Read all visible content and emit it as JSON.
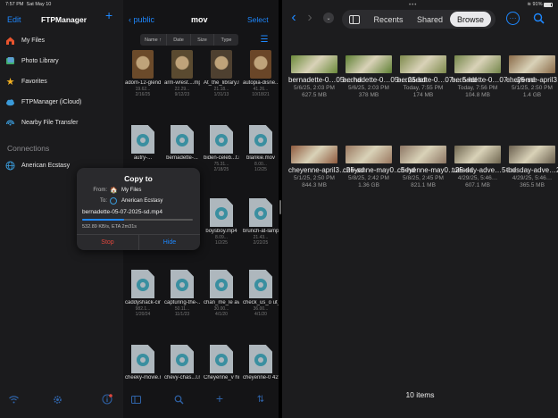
{
  "status_bar": {
    "time": "7:57 PM",
    "date": "Sat May 10",
    "battery_pct": "91%"
  },
  "left_pane": {
    "edit_label": "Edit",
    "title": "FTPManager",
    "add_label": "+",
    "items": [
      {
        "label": "My Files"
      },
      {
        "label": "Photo Library"
      },
      {
        "label": "Favorites"
      },
      {
        "label": "FTPManager (iCloud)"
      },
      {
        "label": "Nearby File Transfer"
      }
    ],
    "connections_header": "Connections",
    "connections": [
      {
        "label": "Anerican Ecstasy"
      }
    ]
  },
  "middle_pane": {
    "back_label": "public",
    "title": "mov",
    "select_label": "Select",
    "sort_tabs": [
      "Name ↑",
      "Date",
      "Size",
      "Type"
    ],
    "files": [
      {
        "name": "adom-12-glend....mp4",
        "size": "19.62...",
        "date": "2/16/25",
        "kind": "video"
      },
      {
        "name": "arm-wrest....mp4",
        "size": "22.29...",
        "date": "9/12/23",
        "kind": "video"
      },
      {
        "name": "At_the_library.mp4",
        "size": "21.18...",
        "date": "1/31/13",
        "kind": "video"
      },
      {
        "name": "autopia-disne....mp4",
        "size": "41.26...",
        "date": "10/18/21",
        "kind": "video"
      },
      {
        "name": "autry-...",
        "size": "",
        "date": "",
        "kind": "icon"
      },
      {
        "name": "bernadette-...",
        "size": "",
        "date": "",
        "kind": "icon"
      },
      {
        "name": "biden-celeb...t.mov",
        "size": "75.31...",
        "date": "2/18/25",
        "kind": "icon"
      },
      {
        "name": "blankie.mov",
        "size": "8.00...",
        "date": "1/2/25",
        "kind": "icon"
      },
      {
        "name": "",
        "size": "",
        "date": "",
        "kind": "icon"
      },
      {
        "name": "",
        "size": "",
        "date": "",
        "kind": "icon"
      },
      {
        "name": "boysboy.mp4",
        "size": "8.09...",
        "date": "1/2/25",
        "kind": "icon"
      },
      {
        "name": "brunch-at-lampl....mp4",
        "size": "21.43...",
        "date": "2/22/25",
        "kind": "icon"
      },
      {
        "name": "caddyshack-cindy....mp4",
        "size": "982.1...",
        "date": "1/20/24",
        "kind": "icon"
      },
      {
        "name": "capturing-the-...nt.mov",
        "size": "50.11...",
        "date": "11/1/23",
        "kind": "icon"
      },
      {
        "name": "chan_me_le aving.mov",
        "size": "30.00...",
        "date": "4/1/20",
        "kind": "icon"
      },
      {
        "name": "check_us_o ut_aug.mp4",
        "size": "36.00...",
        "date": "4/1/20",
        "kind": "icon"
      },
      {
        "name": "cheeky-movie.mp4",
        "size": "",
        "date": "",
        "kind": "icon"
      },
      {
        "name": "chevy-chas...l.mp4",
        "size": "",
        "date": "",
        "kind": "icon"
      },
      {
        "name": "Cheyenne_v his_2.mp4",
        "size": "",
        "date": "",
        "kind": "icon"
      },
      {
        "name": "cheyenne-0 4212...l.mp4",
        "size": "",
        "date": "",
        "kind": "icon"
      }
    ]
  },
  "copy_dialog": {
    "title": "Copy to",
    "from_label": "From:",
    "from_value": "My Files",
    "to_label": "To:",
    "to_value": "Anerican Ecstasy",
    "filename": "bernadette-05-07-2025-sd.mp4",
    "progress": 0.38,
    "rate_text": "532.89 KB/s, ETA 2m31s",
    "stop_label": "Stop",
    "hide_label": "Hide"
  },
  "right_pane": {
    "tabs": [
      "Recents",
      "Shared",
      "Browse"
    ],
    "active_tab": "Browse",
    "items_count": "10 items",
    "files": [
      {
        "name": "bernadette-0…05-…hd",
        "date": "5/6/25, 2:03 PM",
        "size": "627.5 MB",
        "tint": "#6b8a3a"
      },
      {
        "name": "bernadette-0…05-…25-sd",
        "date": "5/6/25, 2:03 PM",
        "size": "378 MB",
        "tint": "#5f8034"
      },
      {
        "name": "bernadette-0…07-…5-hd",
        "date": "Today, 7:55 PM",
        "size": "174 MB",
        "tint": "#7d8a4c"
      },
      {
        "name": "bernadette-0…07-…25-sd",
        "date": "Today, 7:56 PM",
        "size": "104.8 MB",
        "tint": "#74864a"
      },
      {
        "name": "cheyenne-april3…5-hd",
        "date": "5/1/25, 2:50 PM",
        "size": "1.4 GB",
        "tint": "#8a6a48"
      },
      {
        "name": "cheyenne-april3…25-sd",
        "date": "5/1/25, 2:50 PM",
        "size": "844.3 MB",
        "tint": "#8f5a3e"
      },
      {
        "name": "cheyenne-may0…5-hd",
        "date": "5/8/25, 2:42 PM",
        "size": "1.36 GB",
        "tint": "#9a7860"
      },
      {
        "name": "cheyenne-may0…25-sd",
        "date": "5/8/25, 2:45 PM",
        "size": "821.1 MB",
        "tint": "#8d7664"
      },
      {
        "name": "tuesday-adve…5-hd",
        "date": "4/29/25, 5:46…",
        "size": "607.1 MB",
        "tint": "#6f6650"
      },
      {
        "name": "tuesday-adve…25-sd",
        "date": "4/29/25, 5:46…",
        "size": "365.5 MB",
        "tint": "#6a5f4e"
      }
    ]
  },
  "colors": {
    "accent": "#1e88ff",
    "stop": "#e0463c",
    "left_bg": "#1b1b1d",
    "right_bg": "#1c1c1e"
  }
}
